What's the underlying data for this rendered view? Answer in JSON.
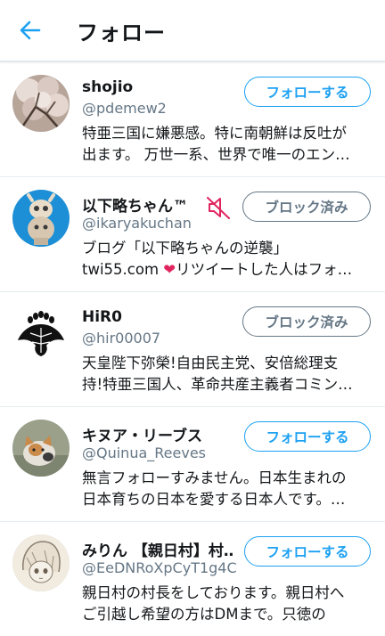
{
  "header": {
    "title": "フォロー"
  },
  "colors": {
    "accent": "#1da1f2",
    "muted": "#657786",
    "mute_icon": "#e0245e"
  },
  "users": [
    {
      "name": "shojio",
      "handle": "@pdemew2",
      "bio_line1": "特亜三国に嫌悪感。特に南朝鮮は反吐が",
      "bio_line2": "出ます。 万世一系、世界で唯一のエン…",
      "button": "フォローする",
      "avatar": "cherry-blossom-photo"
    },
    {
      "name": "以下略ちゃん™",
      "handle": "@ikaryakuchan",
      "bio_line1": "ブログ「以下略ちゃんの逆襲」",
      "bio_line2a": "twi55.com ",
      "bio_heart": "❤",
      "bio_line2b": "リツイートした人はフォ…",
      "button": "ブロック済み",
      "muted_icon": "mute-icon",
      "avatar": "figurine-photo"
    },
    {
      "name": "HiR0",
      "handle": "@hir00007",
      "bio_line1": "天皇陛下弥榮!自由民主党、安倍総理支",
      "bio_line2": "持!特亜三国人、革命共産主義者コミン…",
      "button": "ブロック済み",
      "avatar": "paulownia-crest"
    },
    {
      "name": "キヌア・リーブス",
      "handle": "@Quinua_Reeves",
      "bio_line1": "無言フォローすみません。日本生まれの",
      "bio_line2": "日本育ちの日本を愛する日本人です。…",
      "button": "フォローする",
      "avatar": "cat-photo"
    },
    {
      "name": "みりん 【親日村】村…",
      "handle": "@EeDNRoXpCyT1g4C",
      "bio_line1": "親日村の村長をしております。親日村へ",
      "bio_line2": "ご引越し希望の方はDMまで。只徳の",
      "button": "フォローする",
      "avatar": "anime-sketch"
    }
  ]
}
